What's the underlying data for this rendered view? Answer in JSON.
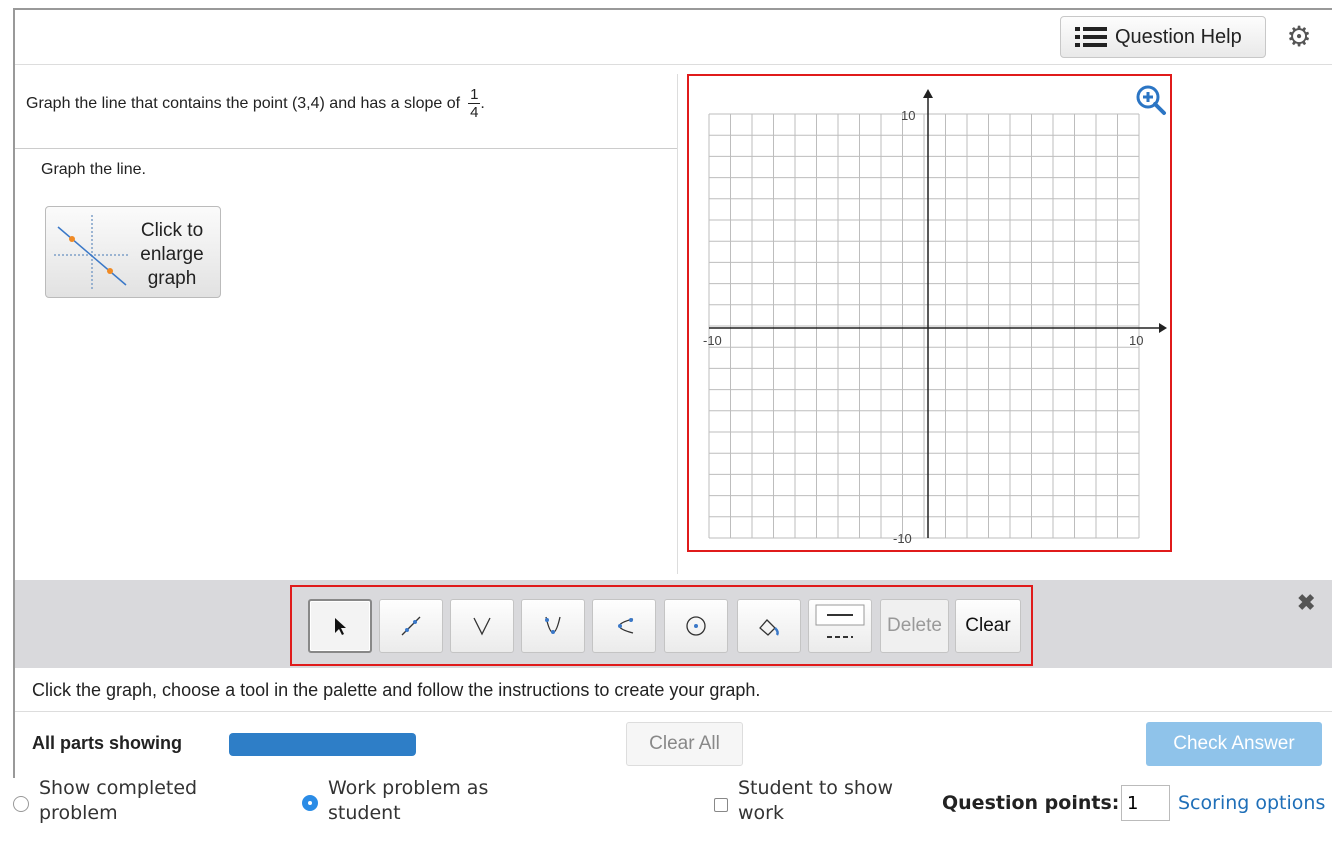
{
  "toolbar": {
    "question_help_label": "Question Help",
    "icons": [
      "list-icon",
      "gear-icon"
    ]
  },
  "question": {
    "prompt": "Graph the line that contains the point (3,4) and has a slope of",
    "slope_numerator": "1",
    "slope_denominator": "4",
    "prompt_end": ".",
    "instruction": "Graph the line.",
    "enlarge_label_1": "Click to",
    "enlarge_label_2": "enlarge",
    "enlarge_label_3": "graph"
  },
  "graph": {
    "x_min_label": "-10",
    "x_max_label": "10",
    "y_max_label": "10",
    "y_min_label": "-10",
    "grid": true,
    "zoom_icon": "zoom-in-icon"
  },
  "palette": {
    "tools": [
      "arrow-pointer-icon",
      "line-tool-icon",
      "absolute-value-icon",
      "parabola-icon",
      "sideways-parabola-icon",
      "circle-icon",
      "fill-tool-icon",
      "line-style-icon"
    ],
    "delete_label": "Delete",
    "clear_label": "Clear"
  },
  "instructions": "Click the graph, choose a tool in the palette and follow the instructions to create your graph.",
  "status": {
    "parts_label": "All parts showing",
    "progress": 1.0,
    "clear_all_label": "Clear All",
    "check_answer_label": "Check Answer"
  },
  "options": {
    "show_completed_1": "Show completed",
    "show_completed_2": "problem",
    "work_as_student_1": "Work problem as",
    "work_as_student_2": "student",
    "student_show_1": "Student to show",
    "student_show_2": "work",
    "question_points_label": "Question points:",
    "question_points_value": "1",
    "scoring_options_label": "Scoring options"
  },
  "colors": {
    "accent": "#2e7ec7",
    "highlight_border": "#e01b1b",
    "check_answer": "#8fc3ea",
    "link": "#1f6fb8"
  }
}
